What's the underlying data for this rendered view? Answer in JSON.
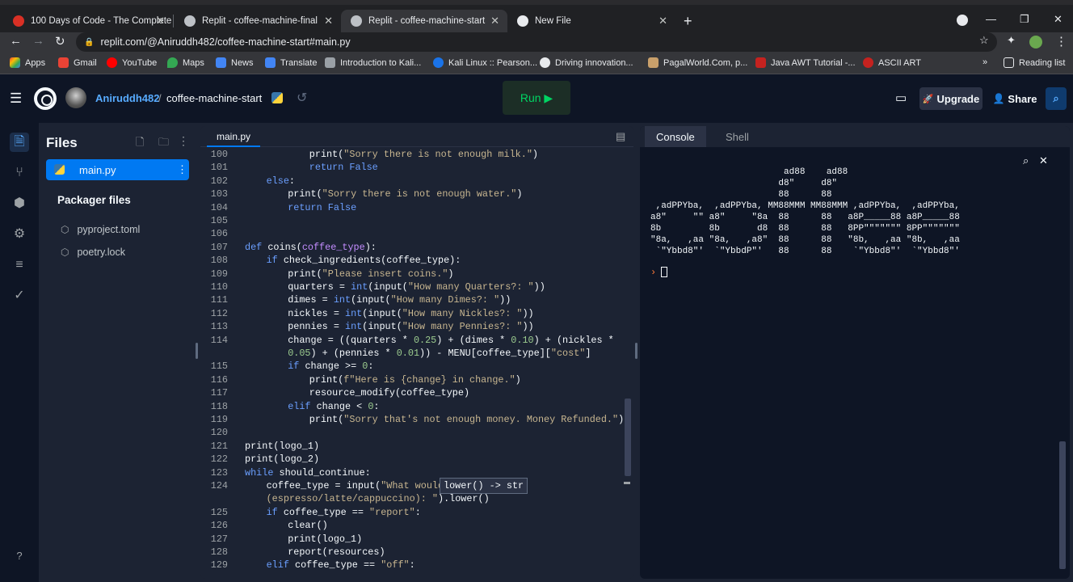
{
  "browser": {
    "tabs": [
      {
        "title": "100 Days of Code - The Complete",
        "color": "#d93025"
      },
      {
        "title": "Replit - coffee-machine-final",
        "color": "#bdc1c6"
      },
      {
        "title": "Replit - coffee-machine-start",
        "color": "#bdc1c6"
      },
      {
        "title": "New File",
        "color": "#e8eaed"
      }
    ],
    "url": "replit.com/@Aniruddh482/coffee-machine-start#main.py",
    "bookmarks": [
      "Apps",
      "Gmail",
      "YouTube",
      "Maps",
      "News",
      "Translate",
      "Introduction to Kali...",
      "Kali Linux :: Pearson...",
      "Driving innovation...",
      "PagalWorld.Com, p...",
      "Java AWT Tutorial -...",
      "ASCII ART"
    ],
    "more_bookmarks": "»",
    "reading_list": "Reading list"
  },
  "header": {
    "user": "Aniruddh482",
    "separator": "/",
    "repl_name": "coffee-machine-start",
    "run_label": "Run ▶",
    "upgrade_label": "Upgrade",
    "share_label": "Share"
  },
  "files": {
    "title": "Files",
    "active_file": "main.py",
    "packager_title": "Packager files",
    "packager_items": [
      "pyproject.toml",
      "poetry.lock"
    ],
    "help": "?"
  },
  "editor": {
    "tab": "main.py",
    "lines": [
      {
        "n": "100",
        "indent": 3,
        "segs": [
          [
            "fn",
            "print("
          ],
          [
            "st",
            "\"Sorry there is not enough milk.\""
          ],
          [
            "fn",
            ")"
          ]
        ]
      },
      {
        "n": "101",
        "indent": 3,
        "segs": [
          [
            "kw",
            "return "
          ],
          [
            "kw",
            "False"
          ]
        ]
      },
      {
        "n": "102",
        "indent": 1,
        "segs": [
          [
            "kw",
            "else"
          ],
          [
            "fn",
            ":"
          ]
        ]
      },
      {
        "n": "103",
        "indent": 2,
        "segs": [
          [
            "fn",
            "print("
          ],
          [
            "st",
            "\"Sorry there is not enough water.\""
          ],
          [
            "fn",
            ")"
          ]
        ]
      },
      {
        "n": "104",
        "indent": 2,
        "segs": [
          [
            "kw",
            "return "
          ],
          [
            "kw",
            "False"
          ]
        ]
      },
      {
        "n": "105",
        "indent": 0,
        "segs": []
      },
      {
        "n": "106",
        "indent": 0,
        "segs": []
      },
      {
        "n": "107",
        "indent": 0,
        "segs": [
          [
            "kw",
            "def "
          ],
          [
            "fn",
            "coins("
          ],
          [
            "bi",
            "coffee_type"
          ],
          [
            "fn",
            "):"
          ]
        ]
      },
      {
        "n": "108",
        "indent": 1,
        "segs": [
          [
            "kw",
            "if "
          ],
          [
            "fn",
            "check_ingredients(coffee_type):"
          ]
        ]
      },
      {
        "n": "109",
        "indent": 2,
        "segs": [
          [
            "fn",
            "print("
          ],
          [
            "st",
            "\"Please insert coins.\""
          ],
          [
            "fn",
            ")"
          ]
        ]
      },
      {
        "n": "110",
        "indent": 2,
        "segs": [
          [
            "fn",
            "quarters = "
          ],
          [
            "kw",
            "int"
          ],
          [
            "fn",
            "(input("
          ],
          [
            "st",
            "\"How many Quarters?: \""
          ],
          [
            "fn",
            "))"
          ]
        ]
      },
      {
        "n": "111",
        "indent": 2,
        "segs": [
          [
            "fn",
            "dimes = "
          ],
          [
            "kw",
            "int"
          ],
          [
            "fn",
            "(input("
          ],
          [
            "st",
            "\"How many Dimes?: \""
          ],
          [
            "fn",
            "))"
          ]
        ]
      },
      {
        "n": "112",
        "indent": 2,
        "segs": [
          [
            "fn",
            "nickles = "
          ],
          [
            "kw",
            "int"
          ],
          [
            "fn",
            "(input("
          ],
          [
            "st",
            "\"How many Nickles?: \""
          ],
          [
            "fn",
            "))"
          ]
        ]
      },
      {
        "n": "113",
        "indent": 2,
        "segs": [
          [
            "fn",
            "pennies = "
          ],
          [
            "kw",
            "int"
          ],
          [
            "fn",
            "(input("
          ],
          [
            "st",
            "\"How many Pennies?: \""
          ],
          [
            "fn",
            "))"
          ]
        ]
      },
      {
        "n": "114",
        "indent": 2,
        "segs": [
          [
            "fn",
            "change = ((quarters * "
          ],
          [
            "nm",
            "0.25"
          ],
          [
            "fn",
            ") + (dimes * "
          ],
          [
            "nm",
            "0.10"
          ],
          [
            "fn",
            ") + (nickles *"
          ]
        ]
      },
      {
        "n": "",
        "indent": 2,
        "segs": [
          [
            "nm",
            "0.05"
          ],
          [
            "fn",
            ") + (pennies * "
          ],
          [
            "nm",
            "0.01"
          ],
          [
            "fn",
            ")) - MENU[coffee_type]["
          ],
          [
            "st",
            "\"cost\""
          ],
          [
            "fn",
            "]"
          ]
        ]
      },
      {
        "n": "115",
        "indent": 2,
        "segs": [
          [
            "kw",
            "if "
          ],
          [
            "fn",
            "change >= "
          ],
          [
            "nm",
            "0"
          ],
          [
            "fn",
            ":"
          ]
        ]
      },
      {
        "n": "116",
        "indent": 3,
        "segs": [
          [
            "fn",
            "print("
          ],
          [
            "st",
            "f\"Here is {change} in change.\""
          ],
          [
            "fn",
            ")"
          ]
        ]
      },
      {
        "n": "117",
        "indent": 3,
        "segs": [
          [
            "fn",
            "resource_modify(coffee_type)"
          ]
        ]
      },
      {
        "n": "118",
        "indent": 2,
        "segs": [
          [
            "kw",
            "elif "
          ],
          [
            "fn",
            "change < "
          ],
          [
            "nm",
            "0"
          ],
          [
            "fn",
            ":"
          ]
        ]
      },
      {
        "n": "119",
        "indent": 3,
        "segs": [
          [
            "fn",
            "print("
          ],
          [
            "st",
            "\"Sorry that's not enough money. Money Refunded.\""
          ],
          [
            "fn",
            ")"
          ]
        ]
      },
      {
        "n": "120",
        "indent": 0,
        "segs": []
      },
      {
        "n": "121",
        "indent": 0,
        "segs": [
          [
            "fn",
            "print(logo_1)"
          ]
        ]
      },
      {
        "n": "122",
        "indent": 0,
        "segs": [
          [
            "fn",
            "print(logo_2)"
          ]
        ]
      },
      {
        "n": "123",
        "indent": 0,
        "segs": [
          [
            "kw",
            "while "
          ],
          [
            "fn",
            "should_continue:"
          ]
        ]
      },
      {
        "n": "124",
        "indent": 1,
        "segs": [
          [
            "fn",
            "coffee_type = input("
          ],
          [
            "st",
            "\"What would"
          ]
        ]
      },
      {
        "n": "",
        "indent": 1,
        "segs": [
          [
            "st",
            "(espresso/latte/cappuccino): \""
          ],
          [
            "fn",
            ").lower()"
          ]
        ]
      },
      {
        "n": "125",
        "indent": 1,
        "segs": [
          [
            "kw",
            "if "
          ],
          [
            "fn",
            "coffee_type == "
          ],
          [
            "st",
            "\"report\""
          ],
          [
            "fn",
            ":"
          ]
        ]
      },
      {
        "n": "126",
        "indent": 2,
        "segs": [
          [
            "fn",
            "clear()"
          ]
        ]
      },
      {
        "n": "127",
        "indent": 2,
        "segs": [
          [
            "fn",
            "print(logo_1)"
          ]
        ]
      },
      {
        "n": "128",
        "indent": 2,
        "segs": [
          [
            "fn",
            "report(resources)"
          ]
        ]
      },
      {
        "n": "129",
        "indent": 1,
        "segs": [
          [
            "kw",
            "elif "
          ],
          [
            "fn",
            "coffee_type == "
          ],
          [
            "st",
            "\"off\""
          ],
          [
            "fn",
            ":"
          ]
        ]
      }
    ],
    "tooltip": "lower() -> str"
  },
  "console": {
    "tabs": [
      "Console",
      "Shell"
    ],
    "ascii_art": "                         ad88    ad88\n                        d8\"     d8\"\n                        88      88\n ,adPPYba,  ,adPPYba, MM88MMM MM88MMM ,adPPYba,  ,adPPYba,\na8\"     \"\" a8\"     \"8a  88      88   a8P_____88 a8P_____88\n8b         8b       d8  88      88   8PP\"\"\"\"\"\"\" 8PP\"\"\"\"\"\"\"\n\"8a,   ,aa \"8a,   ,a8\"  88      88   \"8b,   ,aa \"8b,   ,aa\n `\"Ybbd8\"'  `\"YbbdP\"'   88      88    `\"Ybbd8\"'  `\"Ybbd8\"'",
    "prompt": "›"
  }
}
